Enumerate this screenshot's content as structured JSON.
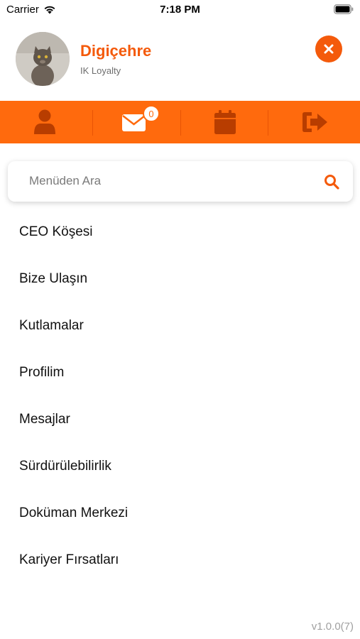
{
  "status_bar": {
    "carrier": "Carrier",
    "time": "7:18 PM"
  },
  "profile": {
    "name": "Digiçehre",
    "subtitle": "IK Loyalty"
  },
  "toolbar": {
    "items": [
      {
        "icon": "user-icon"
      },
      {
        "icon": "mail-icon",
        "badge": "0"
      },
      {
        "icon": "calendar-icon"
      },
      {
        "icon": "logout-icon"
      }
    ]
  },
  "search": {
    "placeholder": "Menüden Ara",
    "value": ""
  },
  "menu": {
    "items": [
      {
        "label": "CEO Köşesi"
      },
      {
        "label": "Bize Ulaşın"
      },
      {
        "label": "Kutlamalar"
      },
      {
        "label": "Profilim"
      },
      {
        "label": "Mesajlar"
      },
      {
        "label": "Sürdürülebilirlik"
      },
      {
        "label": "Doküman Merkezi"
      },
      {
        "label": "Kariyer Fırsatları"
      }
    ]
  },
  "version": "v1.0.0(7)",
  "colors": {
    "accent": "#ff6a0d",
    "accent_dark": "#f45a0b",
    "icon_dark": "#b83d00"
  }
}
